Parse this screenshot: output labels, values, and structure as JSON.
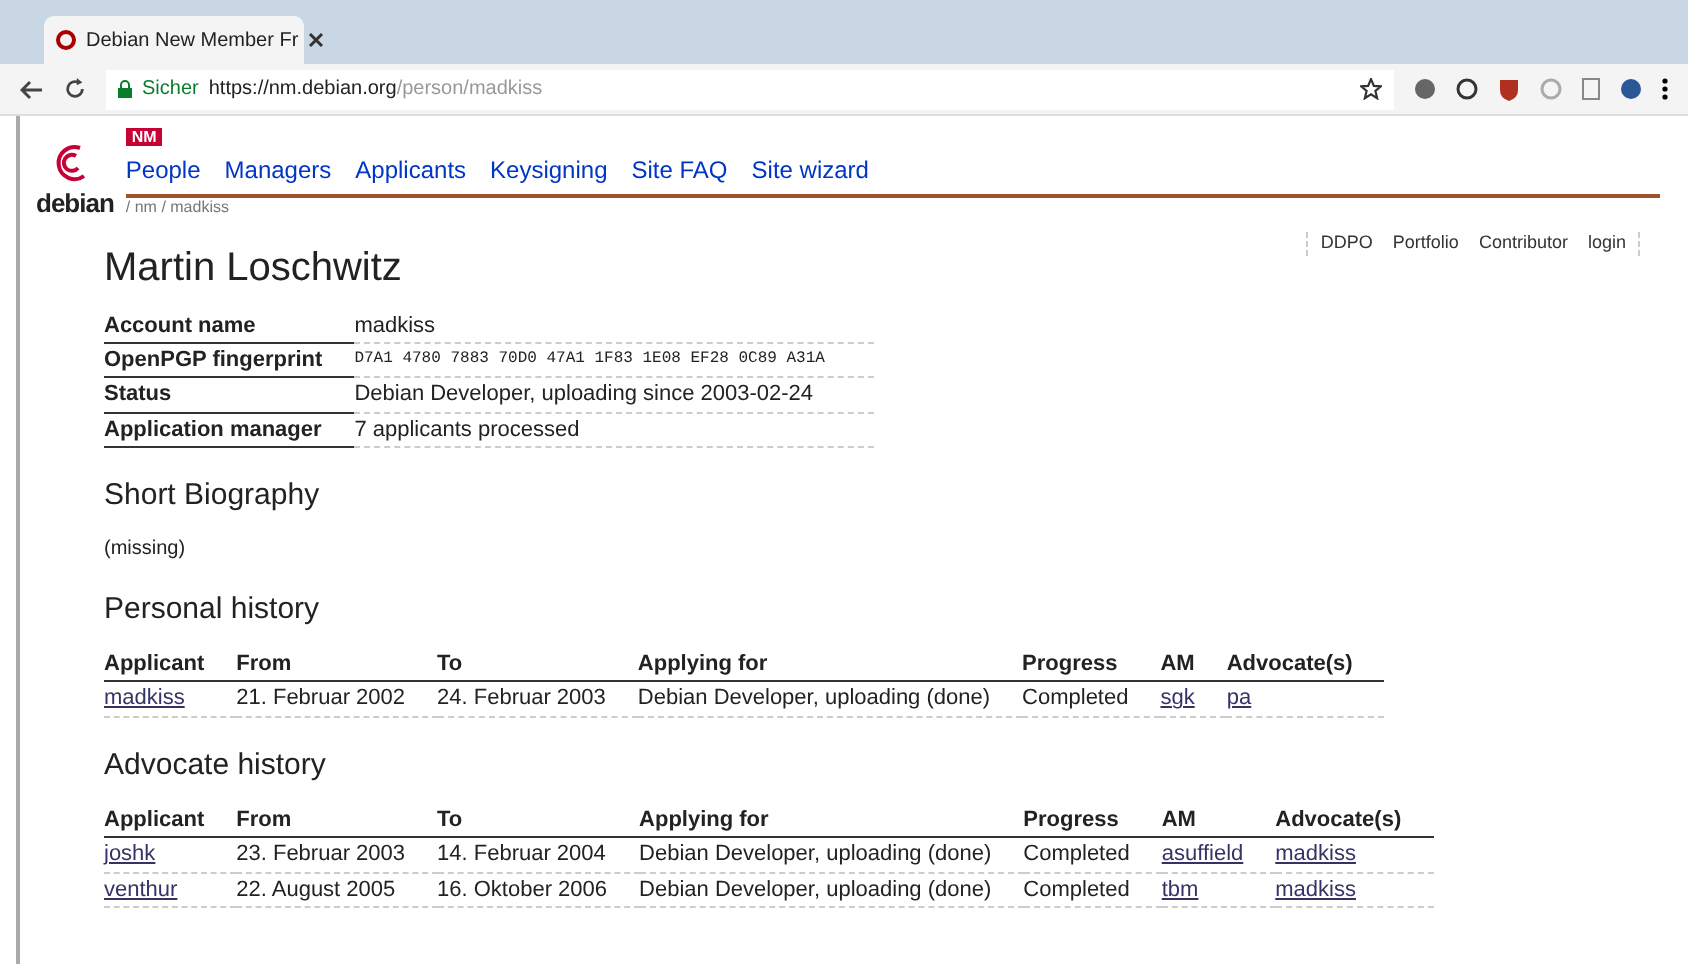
{
  "browser": {
    "tab_title": "Debian New Member Fr",
    "secure_label": "Sicher",
    "url_host": "https://nm.debian.org",
    "url_path": "/person/madkiss"
  },
  "site": {
    "logo_text": "debian",
    "badge": "NM",
    "nav": [
      "People",
      "Managers",
      "Applicants",
      "Keysigning",
      "Site FAQ",
      "Site wizard"
    ],
    "breadcrumb": "/ nm / madkiss",
    "top_links": [
      "DDPO",
      "Portfolio",
      "Contributor",
      "login"
    ]
  },
  "person": {
    "name": "Martin Loschwitz",
    "fields": [
      {
        "label": "Account name",
        "value": "madkiss",
        "kind": "text"
      },
      {
        "label": "OpenPGP fingerprint",
        "value": "D7A1 4780 7883 70D0 47A1  1F83 1E08 EF28 0C89 A31A",
        "kind": "mono"
      },
      {
        "label": "Status",
        "value": "Debian Developer, uploading since 2003-02-24",
        "kind": "text"
      },
      {
        "label": "Application manager",
        "value": "7 applicants processed",
        "kind": "text"
      }
    ]
  },
  "biography": {
    "title": "Short Biography",
    "text": "(missing)"
  },
  "histories": [
    {
      "title": "Personal history",
      "columns": [
        {
          "label": "Applicant",
          "kind": "link"
        },
        {
          "label": "From",
          "kind": "text"
        },
        {
          "label": "To",
          "kind": "text"
        },
        {
          "label": "Applying for",
          "kind": "text"
        },
        {
          "label": "Progress",
          "kind": "text"
        },
        {
          "label": "AM",
          "kind": "link"
        },
        {
          "label": "Advocate(s)",
          "kind": "link"
        }
      ],
      "rows": [
        [
          "madkiss",
          "21. Februar 2002",
          "24. Februar 2003",
          "Debian Developer, uploading (done)",
          "Completed",
          "sgk",
          "pa"
        ]
      ]
    },
    {
      "title": "Advocate history",
      "columns": [
        {
          "label": "Applicant",
          "kind": "link"
        },
        {
          "label": "From",
          "kind": "text"
        },
        {
          "label": "To",
          "kind": "text"
        },
        {
          "label": "Applying for",
          "kind": "text"
        },
        {
          "label": "Progress",
          "kind": "text"
        },
        {
          "label": "AM",
          "kind": "link"
        },
        {
          "label": "Advocate(s)",
          "kind": "link"
        }
      ],
      "rows": [
        [
          "joshk",
          "23. Februar 2003",
          "14. Februar 2004",
          "Debian Developer, uploading (done)",
          "Completed",
          "asuffield",
          "madkiss"
        ],
        [
          "venthur",
          "22. August 2005",
          "16. Oktober 2006",
          "Debian Developer, uploading (done)",
          "Completed",
          "tbm",
          "madkiss"
        ]
      ]
    }
  ]
}
